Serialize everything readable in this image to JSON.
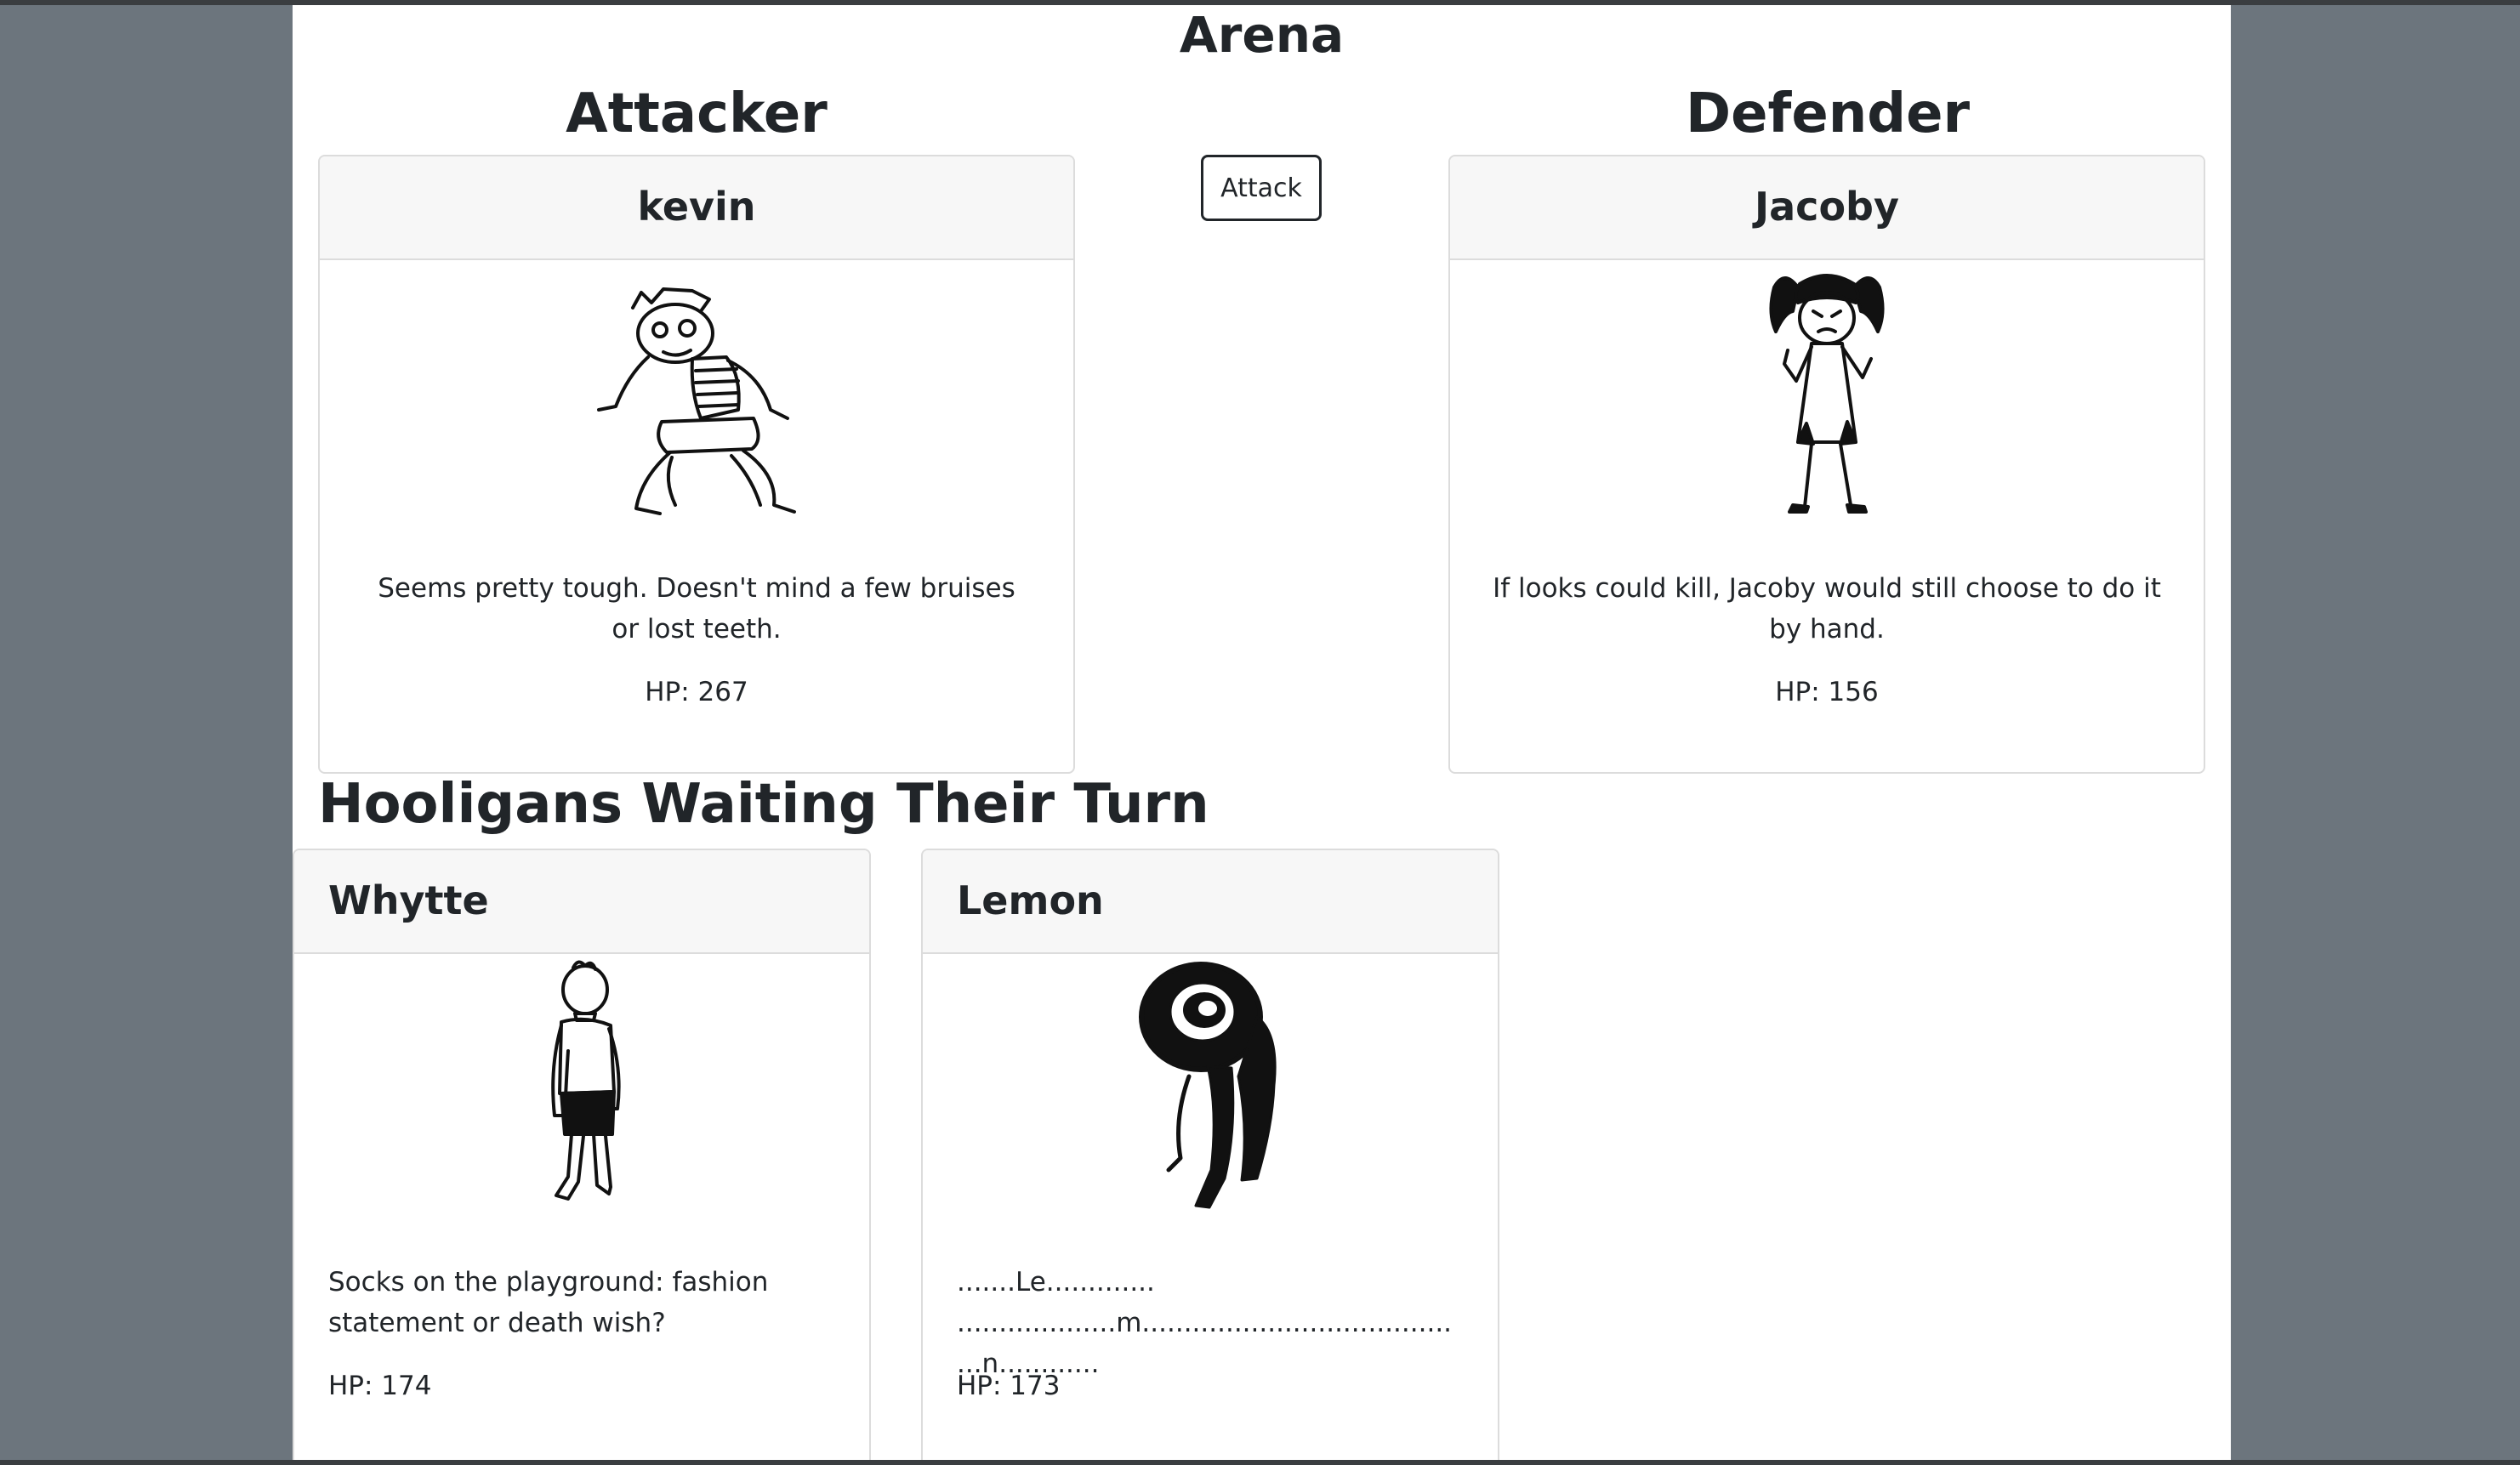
{
  "arena": {
    "title": "Arena",
    "attacker_heading": "Attacker",
    "defender_heading": "Defender",
    "attack_button": "Attack"
  },
  "attacker": {
    "name": "kevin",
    "description": "Seems pretty tough. Doesn't mind a few bruises or lost teeth.",
    "hp": "HP: 267"
  },
  "defender": {
    "name": "Jacoby",
    "description": "If looks could kill, Jacoby would still choose to do it by hand.",
    "hp": "HP: 156"
  },
  "waiting": {
    "title": "Hooligans Waiting Their Turn",
    "cards": [
      {
        "name": "Whytte",
        "description": "Socks on the playground: fashion statement or death wish?",
        "hp": "HP: 174"
      },
      {
        "name": "Lemon",
        "description": ".......Le............. ...................m..................................... ...n............",
        "hp": "HP: 173"
      }
    ]
  },
  "colors": {
    "background": "#6c757d",
    "page": "#ffffff",
    "card_header": "#f7f7f7",
    "card_border": "#dcdcdc",
    "text": "#212529"
  }
}
